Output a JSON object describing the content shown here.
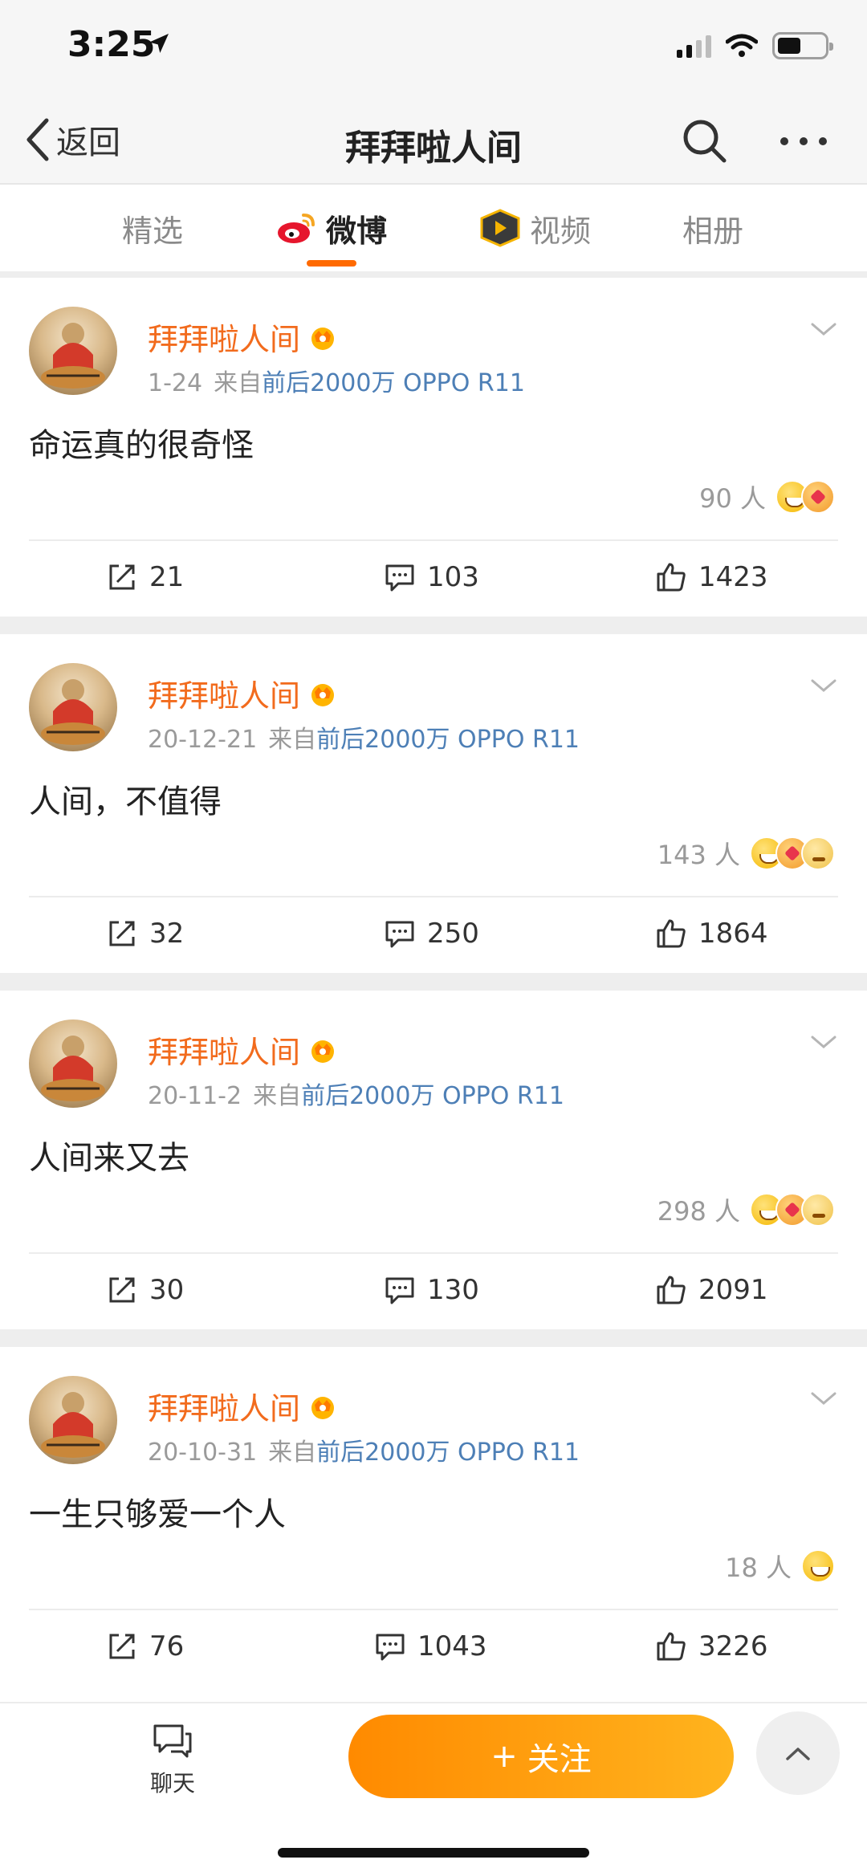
{
  "status_bar": {
    "time": "3:25"
  },
  "nav": {
    "back_label": "返回",
    "title": "拜拜啦人间"
  },
  "tabs": [
    {
      "label": "精选"
    },
    {
      "label": "微博"
    },
    {
      "label": "视频"
    },
    {
      "label": "相册"
    }
  ],
  "posts": [
    {
      "username": "拜拜啦人间",
      "date": "1-24",
      "source_prefix": "来自",
      "source": "前后2000万 OPPO R11",
      "text": "命运真的很奇怪",
      "reactions": "90 人",
      "reposts": "21",
      "comments": "103",
      "likes": "1423"
    },
    {
      "username": "拜拜啦人间",
      "date": "20-12-21",
      "source_prefix": "来自",
      "source": "前后2000万 OPPO R11",
      "text": "人间，不值得",
      "reactions": "143 人",
      "reposts": "32",
      "comments": "250",
      "likes": "1864"
    },
    {
      "username": "拜拜啦人间",
      "date": "20-11-2",
      "source_prefix": "来自",
      "source": "前后2000万 OPPO R11",
      "text": "人间来又去",
      "reactions": "298 人",
      "reposts": "30",
      "comments": "130",
      "likes": "2091"
    },
    {
      "username": "拜拜啦人间",
      "date": "20-10-31",
      "source_prefix": "来自",
      "source": "前后2000万 OPPO R11",
      "text": "一生只够爱一个人",
      "reactions": "18 人",
      "reposts": "76",
      "comments": "1043",
      "likes": "3226"
    }
  ],
  "bottom_bar": {
    "chat_label": "聊天",
    "follow_label": "关注",
    "follow_plus": "+"
  },
  "colors": {
    "accent": "#ff8a00",
    "username": "#f26b1d",
    "source_link": "#4d7fb6"
  },
  "icons": [
    "location-arrow-icon",
    "signal-icon",
    "wifi-icon",
    "battery-icon",
    "back-chevron-icon",
    "search-icon",
    "more-dots-icon",
    "weibo-logo-icon",
    "video-play-icon",
    "crown-badge-icon",
    "chevron-down-icon",
    "repost-icon",
    "comment-icon",
    "like-icon",
    "chat-icon",
    "arrow-up-icon"
  ]
}
